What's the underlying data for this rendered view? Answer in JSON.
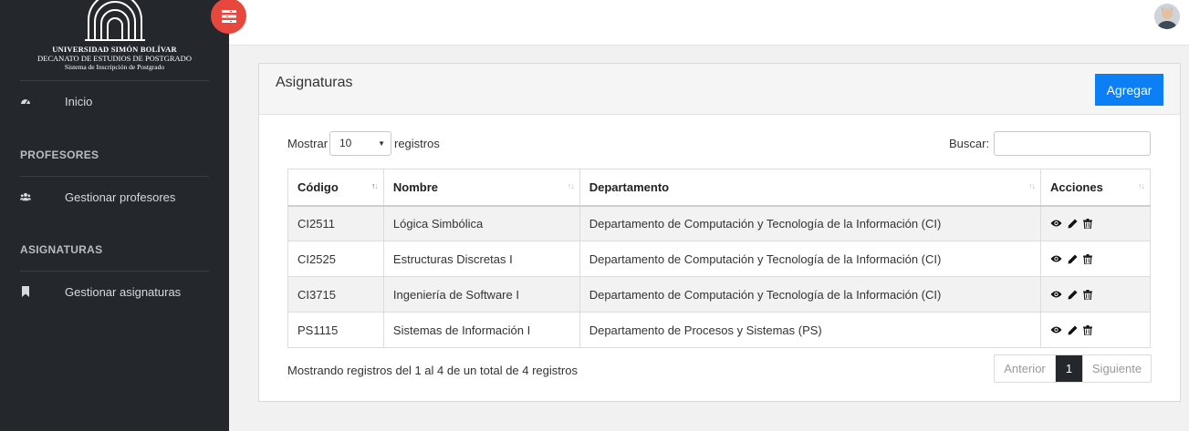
{
  "brand": {
    "line1": "UNIVERSIDAD SIMÓN BOLÍVAR",
    "line2": "DECANATO DE ESTUDIOS DE POSTGRADO",
    "line3": "Sistema de Inscripción de Postgrado"
  },
  "sidebar": {
    "home": {
      "label": "Inicio",
      "icon": "dashboard-icon"
    },
    "sections": [
      {
        "title": "PROFESORES",
        "items": [
          {
            "label": "Gestionar profesores",
            "icon": "users-icon"
          }
        ]
      },
      {
        "title": "ASIGNATURAS",
        "items": [
          {
            "label": "Gestionar asignaturas",
            "icon": "bookmark-icon"
          }
        ]
      }
    ]
  },
  "panel": {
    "title": "Asignaturas",
    "add_label": "Agregar"
  },
  "controls": {
    "show_label": "Mostrar",
    "page_size": "10",
    "records_label": "registros",
    "search_label": "Buscar:",
    "search_value": ""
  },
  "table": {
    "columns": [
      "Código",
      "Nombre",
      "Departamento",
      "Acciones"
    ],
    "rows": [
      {
        "codigo": "CI2511",
        "nombre": "Lógica Simbólica",
        "departamento": "Departamento de Computación y Tecnología de la Información (CI)"
      },
      {
        "codigo": "CI2525",
        "nombre": "Estructuras Discretas I",
        "departamento": "Departamento de Computación y Tecnología de la Información (CI)"
      },
      {
        "codigo": "CI3715",
        "nombre": "Ingeniería de Software I",
        "departamento": "Departamento de Computación y Tecnología de la Información (CI)"
      },
      {
        "codigo": "PS1115",
        "nombre": "Sistemas de Información I",
        "departamento": "Departamento de Procesos y Sistemas (PS)"
      }
    ]
  },
  "footer": {
    "info": "Mostrando registros del 1 al 4 de un total de 4 registros",
    "prev": "Anterior",
    "current_page": "1",
    "next": "Siguiente"
  },
  "colors": {
    "sidebar": "#24282d",
    "toggle": "#e8473d",
    "primary": "#0d7ff4"
  }
}
